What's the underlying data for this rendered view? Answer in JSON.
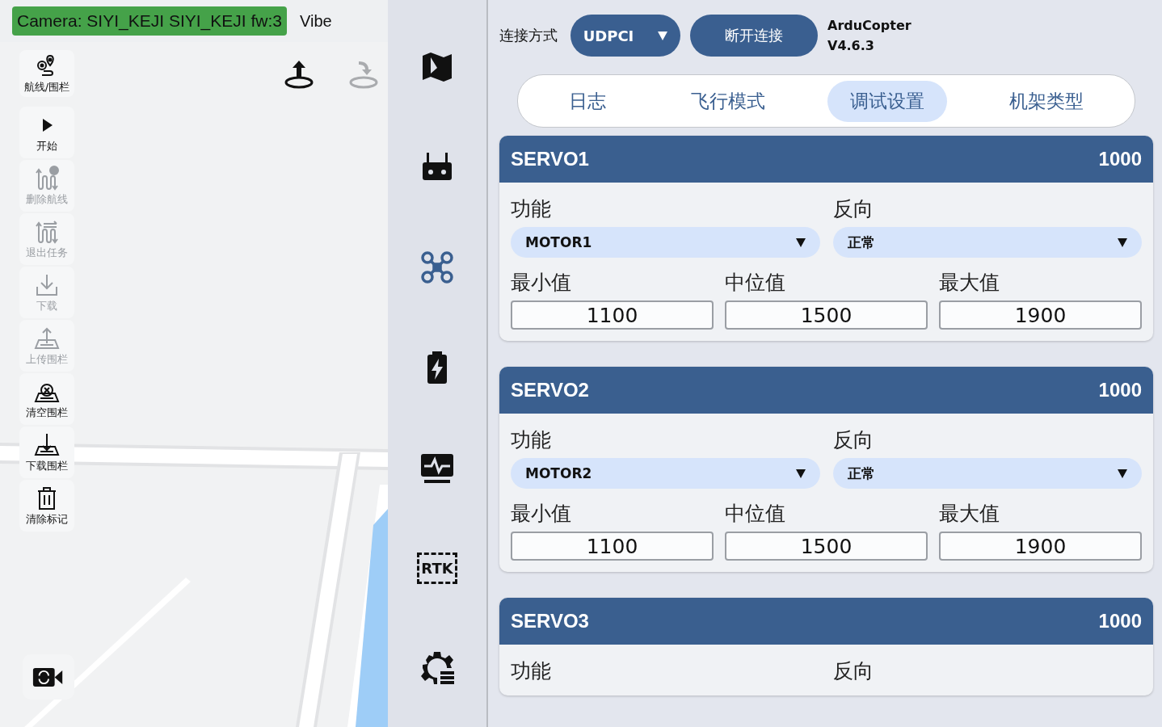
{
  "camera_badge": "Camera: SIYI_KEJI SIYI_KEJI fw:3",
  "vibe": "Vibe",
  "toolbar": [
    {
      "kind": "route",
      "label": "航线/围栏",
      "disabled": false
    },
    {
      "kind": "play",
      "label": "开始",
      "disabled": false
    },
    {
      "kind": "deleteroute",
      "label": "删除航线",
      "disabled": true
    },
    {
      "kind": "exitmission",
      "label": "退出任务",
      "disabled": true
    },
    {
      "kind": "download",
      "label": "下载",
      "disabled": true
    },
    {
      "kind": "uploadfence",
      "label": "上传围栏",
      "disabled": true
    },
    {
      "kind": "clearfence",
      "label": "清空围栏",
      "disabled": false
    },
    {
      "kind": "downloadfence",
      "label": "下载围栏",
      "disabled": false
    },
    {
      "kind": "trash",
      "label": "清除标记",
      "disabled": false
    }
  ],
  "map_actions": [
    {
      "kind": "takeoff",
      "disabled": false
    },
    {
      "kind": "land",
      "disabled": true
    }
  ],
  "nav": [
    {
      "kind": "map",
      "selected": false
    },
    {
      "kind": "remote",
      "selected": false
    },
    {
      "kind": "drone",
      "selected": true
    },
    {
      "kind": "battery",
      "selected": false
    },
    {
      "kind": "monitor",
      "selected": false
    },
    {
      "kind": "rtk",
      "label": "RTK",
      "selected": false
    },
    {
      "kind": "settings",
      "selected": false
    }
  ],
  "connection": {
    "label": "连接方式",
    "value": "UDPCI",
    "button": "断开连接",
    "firmware": [
      "ArduCopter",
      "V4.6.3"
    ]
  },
  "tabs": [
    {
      "label": "日志",
      "selected": false
    },
    {
      "label": "飞行模式",
      "selected": false
    },
    {
      "label": "调试设置",
      "selected": true
    },
    {
      "label": "机架类型",
      "selected": false
    }
  ],
  "servos": [
    {
      "name": "SERVO1",
      "value": "1000",
      "function_label": "功能",
      "function": "MOTOR1",
      "reverse_label": "反向",
      "reverse": "正常",
      "min_label": "最小值",
      "min": "1100",
      "mid_label": "中位值",
      "mid": "1500",
      "max_label": "最大值",
      "max": "1900"
    },
    {
      "name": "SERVO2",
      "value": "1000",
      "function_label": "功能",
      "function": "MOTOR2",
      "reverse_label": "反向",
      "reverse": "正常",
      "min_label": "最小值",
      "min": "1100",
      "mid_label": "中位值",
      "mid": "1500",
      "max_label": "最大值",
      "max": "1900"
    },
    {
      "name": "SERVO3",
      "value": "1000",
      "function_label": "功能",
      "reverse_label": "反向"
    }
  ]
}
